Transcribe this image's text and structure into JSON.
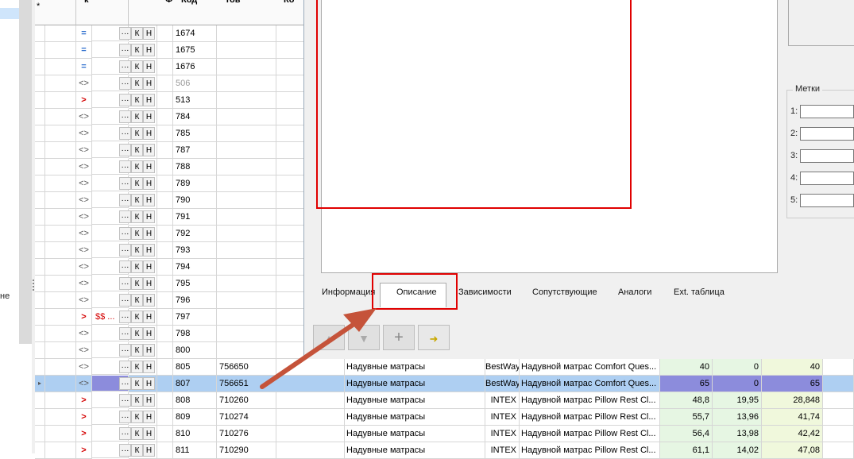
{
  "left_note": "не",
  "grid": {
    "headers": [
      "к",
      "*",
      "Ф",
      "Код",
      "Тов",
      "Ко"
    ],
    "new_row_marker": "*",
    "btn_labels": {
      "dots": "···",
      "k": "К",
      "n": "Н"
    },
    "rows": [
      {
        "mark": "=",
        "mtype": "eq",
        "code": "1674",
        "bar": "",
        "group": "",
        "brand": "",
        "name": "",
        "v1": "",
        "v2": "",
        "v3": ""
      },
      {
        "mark": "=",
        "mtype": "eq",
        "code": "1675",
        "bar": "",
        "group": "",
        "brand": "",
        "name": "",
        "v1": "",
        "v2": "",
        "v3": ""
      },
      {
        "mark": "=",
        "mtype": "eq",
        "code": "1676",
        "bar": "",
        "group": "",
        "brand": "",
        "name": "",
        "v1": "",
        "v2": "",
        "v3": ""
      },
      {
        "mark": "<>",
        "mtype": "br",
        "code": "506",
        "grey": true,
        "bar": "",
        "group": "",
        "brand": "",
        "name": "",
        "v1": "",
        "v2": "",
        "v3": ""
      },
      {
        "mark": ">",
        "mtype": "gt",
        "code": "513",
        "bar": "",
        "group": "",
        "brand": "",
        "name": "",
        "v1": "",
        "v2": "",
        "v3": ""
      },
      {
        "mark": "<>",
        "mtype": "br",
        "code": "784",
        "bar": "",
        "group": "",
        "brand": "",
        "name": "",
        "v1": "",
        "v2": "",
        "v3": ""
      },
      {
        "mark": "<>",
        "mtype": "br",
        "code": "785",
        "bar": "",
        "group": "",
        "brand": "",
        "name": "",
        "v1": "",
        "v2": "",
        "v3": ""
      },
      {
        "mark": "<>",
        "mtype": "br",
        "code": "787",
        "bar": "",
        "group": "",
        "brand": "",
        "name": "",
        "v1": "",
        "v2": "",
        "v3": ""
      },
      {
        "mark": "<>",
        "mtype": "br",
        "code": "788",
        "bar": "",
        "group": "",
        "brand": "",
        "name": "",
        "v1": "",
        "v2": "",
        "v3": ""
      },
      {
        "mark": "<>",
        "mtype": "br",
        "code": "789",
        "bar": "",
        "group": "",
        "brand": "",
        "name": "",
        "v1": "",
        "v2": "",
        "v3": ""
      },
      {
        "mark": "<>",
        "mtype": "br",
        "code": "790",
        "bar": "",
        "group": "",
        "brand": "",
        "name": "",
        "v1": "",
        "v2": "",
        "v3": ""
      },
      {
        "mark": "<>",
        "mtype": "br",
        "code": "791",
        "bar": "",
        "group": "",
        "brand": "",
        "name": "",
        "v1": "",
        "v2": "",
        "v3": ""
      },
      {
        "mark": "<>",
        "mtype": "br",
        "code": "792",
        "bar": "",
        "group": "",
        "brand": "",
        "name": "",
        "v1": "",
        "v2": "",
        "v3": ""
      },
      {
        "mark": "<>",
        "mtype": "br",
        "code": "793",
        "bar": "",
        "group": "",
        "brand": "",
        "name": "",
        "v1": "",
        "v2": "",
        "v3": ""
      },
      {
        "mark": "<>",
        "mtype": "br",
        "code": "794",
        "bar": "",
        "group": "",
        "brand": "",
        "name": "",
        "v1": "",
        "v2": "",
        "v3": ""
      },
      {
        "mark": "<>",
        "mtype": "br",
        "code": "795",
        "bar": "",
        "group": "",
        "brand": "",
        "name": "",
        "v1": "",
        "v2": "",
        "v3": ""
      },
      {
        "mark": "<>",
        "mtype": "br",
        "code": "796",
        "bar": "",
        "group": "",
        "brand": "",
        "name": "",
        "v1": "",
        "v2": "",
        "v3": ""
      },
      {
        "mark": ">",
        "mtype": "gt",
        "code": "797",
        "extra": "$$ ...",
        "bar": "",
        "group": "",
        "brand": "",
        "name": "",
        "v1": "",
        "v2": "",
        "v3": ""
      },
      {
        "mark": "<>",
        "mtype": "br",
        "code": "798",
        "bar": "",
        "group": "",
        "brand": "",
        "name": "",
        "v1": "",
        "v2": "",
        "v3": ""
      },
      {
        "mark": "<>",
        "mtype": "br",
        "code": "800",
        "bar": "",
        "group": "",
        "brand": "",
        "name": "",
        "v1": "",
        "v2": "",
        "v3": ""
      },
      {
        "mark": "<>",
        "mtype": "br",
        "code": "805",
        "bar": "756650",
        "group": "Надувные матрасы",
        "brand": "BestWay",
        "name": "Надувной матрас Comfort Ques...",
        "v1": "40",
        "v2": "0",
        "v3": "40"
      },
      {
        "mark": "<>",
        "mtype": "br",
        "code": "807",
        "bar": "756651",
        "group": "Надувные матрасы",
        "brand": "BestWay",
        "name": "Надувной матрас Comfort Ques...",
        "v1": "65",
        "v2": "0",
        "v3": "65",
        "selected": true
      },
      {
        "mark": ">",
        "mtype": "gt",
        "code": "808",
        "bar": "710260",
        "group": "Надувные матрасы",
        "brand": "INTEX",
        "name": "Надувной матрас Pillow Rest Cl...",
        "v1": "48,8",
        "v2": "19,95",
        "v3": "28,848"
      },
      {
        "mark": ">",
        "mtype": "gt",
        "code": "809",
        "bar": "710274",
        "group": "Надувные матрасы",
        "brand": "INTEX",
        "name": "Надувной матрас Pillow Rest Cl...",
        "v1": "55,7",
        "v2": "13,96",
        "v3": "41,74"
      },
      {
        "mark": ">",
        "mtype": "gt",
        "code": "810",
        "bar": "710276",
        "group": "Надувные матрасы",
        "brand": "INTEX",
        "name": "Надувной матрас Pillow Rest Cl...",
        "v1": "56,4",
        "v2": "13,98",
        "v3": "42,42"
      },
      {
        "mark": ">",
        "mtype": "gt",
        "code": "811",
        "bar": "710290",
        "group": "Надувные матрасы",
        "brand": "INTEX",
        "name": "Надувной матрас Pillow Rest Cl...",
        "v1": "61,1",
        "v2": "14,02",
        "v3": "47,08"
      }
    ]
  },
  "dialog": {
    "tags_legend": "Метки",
    "tags": [
      "1:",
      "2:",
      "3:",
      "4:",
      "5:"
    ],
    "tabs": [
      "Информация",
      "Описание",
      "Зависимости",
      "Сопутствующие",
      "Аналоги",
      "Ext. таблица"
    ],
    "active_tab": "Описание",
    "nav_buttons": [
      {
        "name": "move-up",
        "icon": "triangle-up-icon",
        "glyph": "▲"
      },
      {
        "name": "move-down",
        "icon": "triangle-down-icon",
        "glyph": "▼"
      },
      {
        "name": "add",
        "icon": "plus-icon",
        "glyph": "+"
      },
      {
        "name": "export",
        "icon": "export-icon",
        "glyph": "➜"
      }
    ]
  },
  "colors": {
    "highlight": "#e00000",
    "selection": "#aecff2",
    "selection_dark": "#8c8cdc",
    "value_green": "#e6f6e3",
    "arrow": "#c5533a"
  }
}
